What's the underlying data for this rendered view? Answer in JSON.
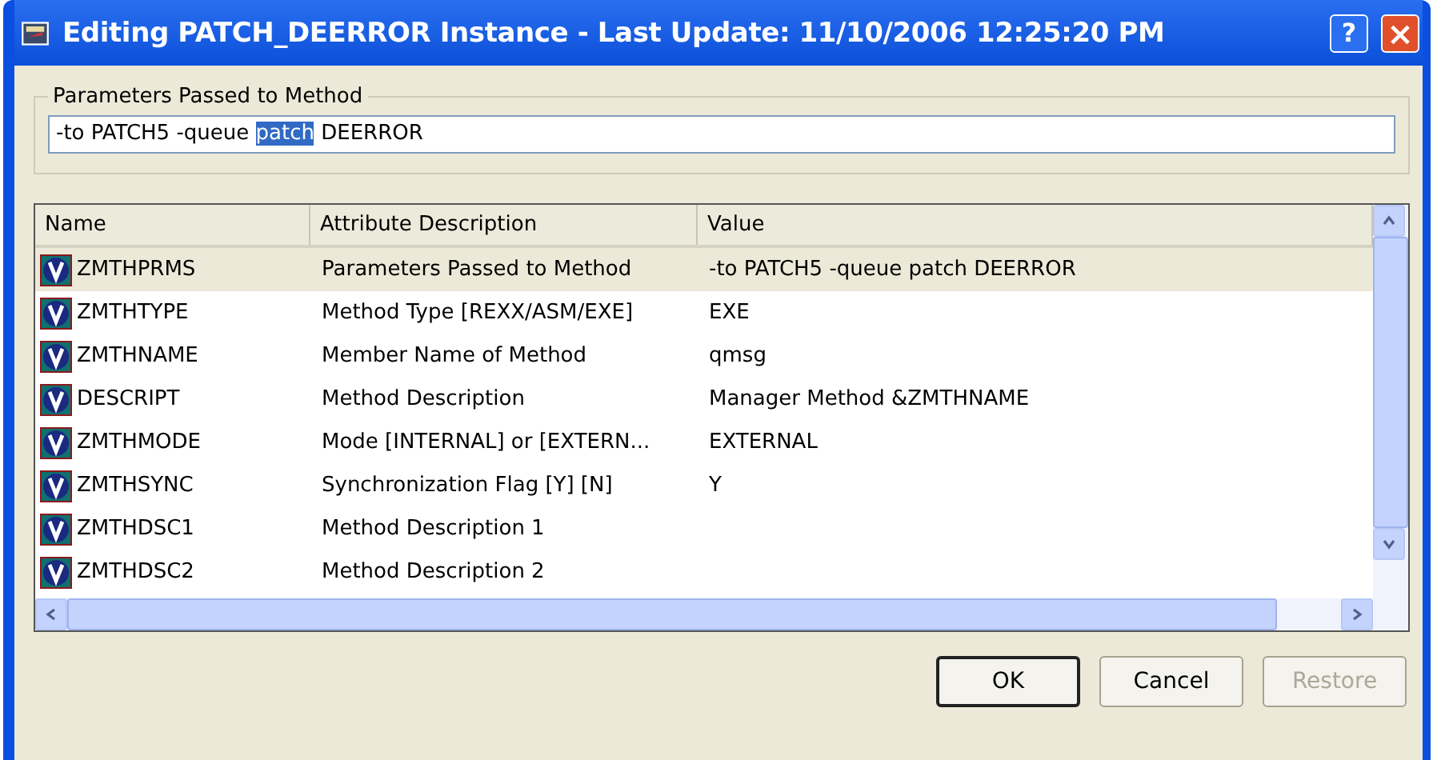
{
  "window": {
    "title": "Editing PATCH_DEERROR Instance - Last Update: 11/10/2006 12:25:20 PM",
    "help": "?",
    "close": "×"
  },
  "parameters": {
    "legend": "Parameters Passed to Method",
    "value_parts": [
      {
        "text": "-to PATCH5 -queue ",
        "selected": false
      },
      {
        "text": "patch",
        "selected": true
      },
      {
        "text": " DEERROR",
        "selected": false
      }
    ]
  },
  "table": {
    "columns": [
      "Name",
      "Attribute Description",
      "Value"
    ],
    "rows": [
      {
        "name": "ZMTHPRMS",
        "description": "Parameters Passed to Method",
        "value": "-to PATCH5 -queue patch DEERROR",
        "selected": true
      },
      {
        "name": "ZMTHTYPE",
        "description": "Method Type [REXX/ASM/EXE]",
        "value": "EXE",
        "selected": false
      },
      {
        "name": "ZMTHNAME",
        "description": "Member Name of Method",
        "value": "qmsg",
        "selected": false
      },
      {
        "name": "DESCRIPT",
        "description": "Method Description",
        "value": "Manager Method &ZMTHNAME",
        "selected": false
      },
      {
        "name": "ZMTHMODE",
        "description": "Mode [INTERNAL] or [EXTERN...",
        "value": "EXTERNAL",
        "selected": false
      },
      {
        "name": "ZMTHSYNC",
        "description": "Synchronization Flag [Y] [N]",
        "value": "Y",
        "selected": false
      },
      {
        "name": "ZMTHDSC1",
        "description": "Method Description 1",
        "value": "",
        "selected": false
      },
      {
        "name": "ZMTHDSC2",
        "description": "Method Description 2",
        "value": "",
        "selected": false
      }
    ]
  },
  "buttons": [
    {
      "label": "OK",
      "disabled": false,
      "default": true
    },
    {
      "label": "Cancel",
      "disabled": false,
      "default": false
    },
    {
      "label": "Restore",
      "disabled": true,
      "default": false
    }
  ]
}
